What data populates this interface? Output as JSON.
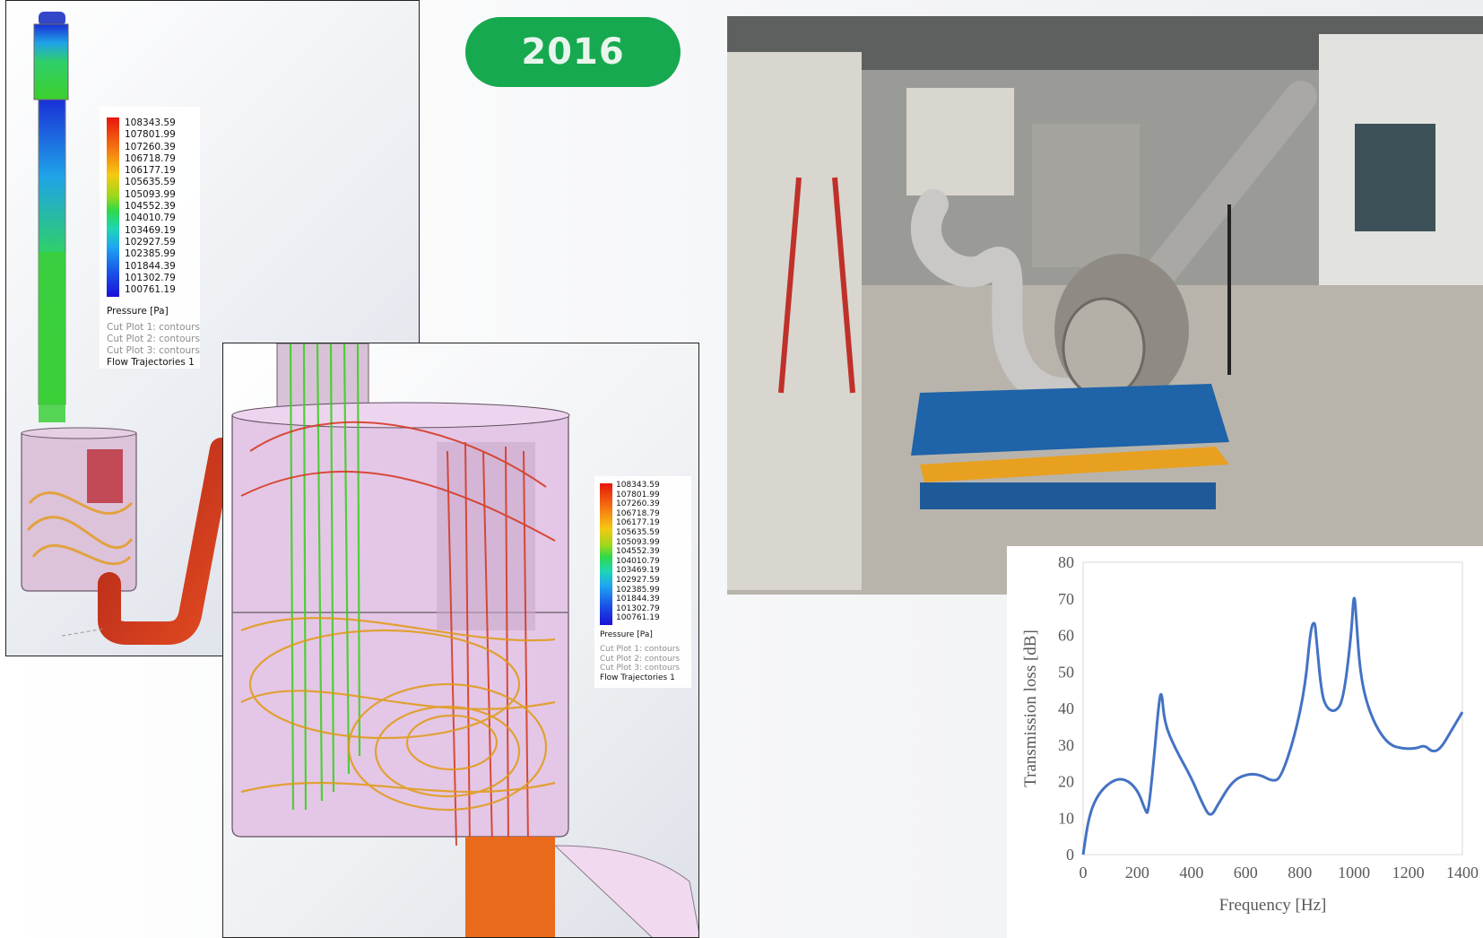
{
  "year_badge": "2016",
  "simulation_legend": {
    "ticks": [
      "108343.59",
      "107801.99",
      "107260.39",
      "106718.79",
      "106177.19",
      "105635.59",
      "105093.99",
      "104552.39",
      "104010.79",
      "103469.19",
      "102927.59",
      "102385.99",
      "101844.39",
      "101302.79",
      "100761.19"
    ],
    "unit_label": "Pressure [Pa]",
    "plots": [
      "Cut Plot 1: contours",
      "Cut Plot 2: contours",
      "Cut Plot 3: contours",
      "Flow Trajectories 1"
    ]
  },
  "colors": {
    "badge": "#16a94f",
    "curve": "#4472c4"
  },
  "chart_data": {
    "type": "line",
    "xlabel": "Frequency [Hz]",
    "ylabel": "Transmission loss [dB]",
    "xlim": [
      0,
      1400
    ],
    "ylim": [
      0,
      80
    ],
    "x_ticks": [
      0,
      200,
      400,
      600,
      800,
      1000,
      1200,
      1400
    ],
    "y_ticks": [
      0,
      10,
      20,
      30,
      40,
      50,
      60,
      70,
      80
    ],
    "grid": false,
    "series": [
      {
        "x": [
          0,
          20,
          50,
          100,
          150,
          200,
          230,
          240,
          260,
          280,
          290,
          300,
          340,
          400,
          440,
          470,
          500,
          550,
          600,
          650,
          700,
          730,
          780,
          820,
          840,
          855,
          860,
          880,
          900,
          930,
          960,
          990,
          1000,
          1010,
          1020,
          1040,
          1080,
          1130,
          1180,
          1230,
          1260,
          1290,
          1320,
          1360,
          1400
        ],
        "values": [
          0,
          10,
          16,
          20,
          21,
          18,
          12,
          11,
          25,
          42,
          45,
          36,
          29,
          21,
          14,
          10,
          14,
          20,
          22,
          22,
          20,
          21,
          32,
          46,
          62,
          64,
          60,
          44,
          40,
          39,
          42,
          60,
          73,
          63,
          52,
          43,
          35,
          30,
          29,
          29,
          30,
          28,
          29,
          34,
          39
        ]
      }
    ]
  }
}
